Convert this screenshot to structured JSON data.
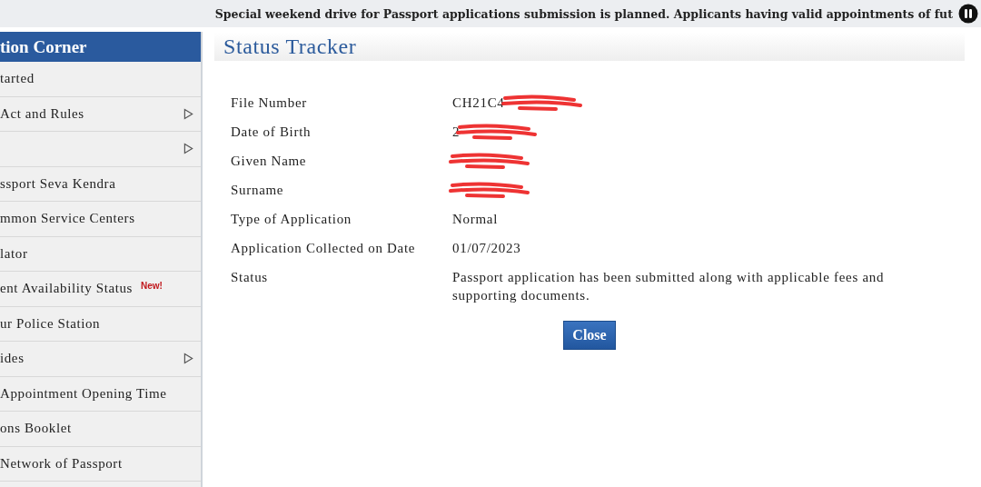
{
  "ticker": {
    "text": "Special weekend drive for Passport applications submission is planned. Applicants having valid appointments of fut"
  },
  "sidebar": {
    "title": "tion Corner",
    "items": [
      {
        "label": "tarted",
        "submenu": false
      },
      {
        "label": "Act and Rules",
        "submenu": true
      },
      {
        "submenu": true
      },
      {
        "label": "ssport Seva Kendra",
        "submenu": false
      },
      {
        "label": "mmon Service Centers",
        "submenu": false
      },
      {
        "label": "lator",
        "submenu": false
      },
      {
        "label": "ent Availability Status",
        "submenu": false,
        "new_badge": "New!"
      },
      {
        "label": "ur Police Station",
        "submenu": false
      },
      {
        "label": "ides",
        "submenu": true
      },
      {
        "label": "Appointment Opening Time",
        "submenu": false
      },
      {
        "label": "ons Booklet",
        "submenu": false
      },
      {
        "label": "Network of Passport",
        "submenu": false
      }
    ]
  },
  "status_tracker": {
    "title": "Status Tracker",
    "fields": [
      {
        "label": "File Number",
        "value": "CH21C4",
        "redacted": true
      },
      {
        "label": "Date of Birth",
        "value": "2",
        "redacted": true
      },
      {
        "label": "Given Name",
        "redacted": true
      },
      {
        "label": "Surname",
        "redacted": true
      },
      {
        "label": "Type of Application",
        "value": "Normal"
      },
      {
        "label": "Application Collected on Date",
        "value": "01/07/2023"
      },
      {
        "label": "Status",
        "value": "Passport application has been submitted along with applicable fees and supporting documents."
      }
    ],
    "button": "Close"
  }
}
